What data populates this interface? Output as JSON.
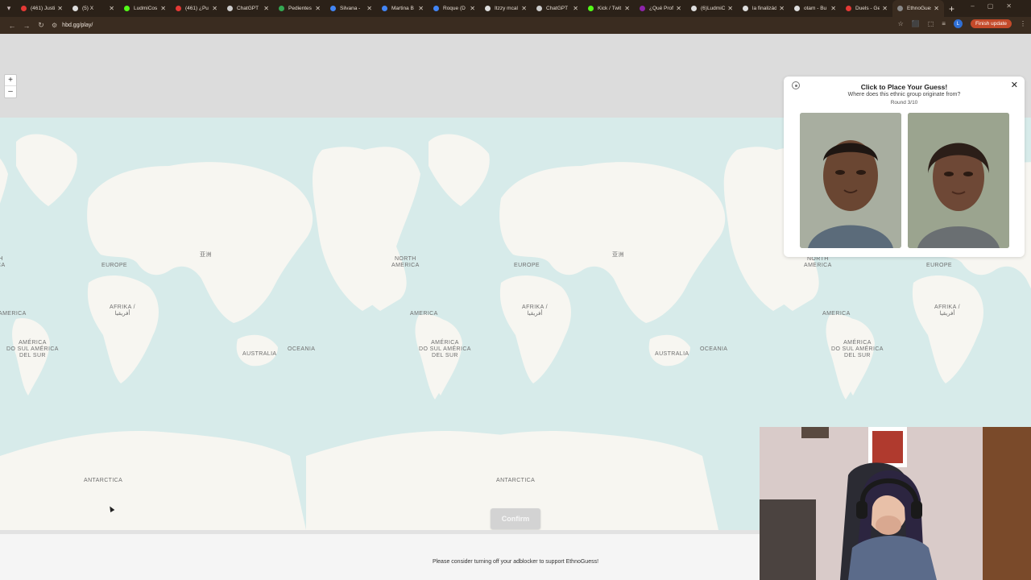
{
  "browser": {
    "tabs": [
      {
        "title": "(461) Justi",
        "color": "#e53935"
      },
      {
        "title": "(5) X",
        "color": "#dddddd"
      },
      {
        "title": "LudmiCos",
        "color": "#53fc18"
      },
      {
        "title": "(461) ¿Pu",
        "color": "#e53935"
      },
      {
        "title": "ChatGPT",
        "color": "#cccccc"
      },
      {
        "title": "Pedientes",
        "color": "#34a853"
      },
      {
        "title": "Silvana - ",
        "color": "#4285f4"
      },
      {
        "title": "Martina B",
        "color": "#4285f4"
      },
      {
        "title": "Roque (D",
        "color": "#4285f4"
      },
      {
        "title": "Itzzy mcal",
        "color": "#dddddd"
      },
      {
        "title": "ChatGPT",
        "color": "#cccccc"
      },
      {
        "title": "Kick / Twit",
        "color": "#53fc18"
      },
      {
        "title": "¿Qué Profe",
        "color": "#8e24aa"
      },
      {
        "title": "(6)LudmiC",
        "color": "#dddddd"
      },
      {
        "title": "la finalizád",
        "color": "#dddddd"
      },
      {
        "title": "otam - Bu",
        "color": "#dddddd"
      },
      {
        "title": "Duels - Ge",
        "color": "#e53935"
      },
      {
        "title": "EthnoGues",
        "color": "#888888",
        "active": true
      }
    ],
    "url": "hbd.gg/play/",
    "finish_update_label": "Finish update",
    "profile_initial": "L"
  },
  "map": {
    "zoom_in": "+",
    "zoom_out": "–",
    "labels": {
      "north_america": [
        "NORTH",
        "AMERICA"
      ],
      "south_america": [
        "AMÉRICA",
        "DO SUL",
        "AMÉRICA",
        "DEL SUR"
      ],
      "europe": "EUROPE",
      "africa": [
        "AFRIKA /",
        "أفريقيا"
      ],
      "asia": "亚洲",
      "australia": "AUSTRALIA",
      "oceania": "OCEANIA",
      "antarctica": "ANTARCTICA",
      "america": "AMERICA"
    }
  },
  "guess_panel": {
    "title": "Click to Place Your Guess!",
    "question": "Where does this ethnic group originate from?",
    "round": "Round 3/10",
    "close": "✕"
  },
  "confirm_label": "Confirm",
  "adblock_notice": "Please consider turning off your adblocker to support EthnoGuess!"
}
